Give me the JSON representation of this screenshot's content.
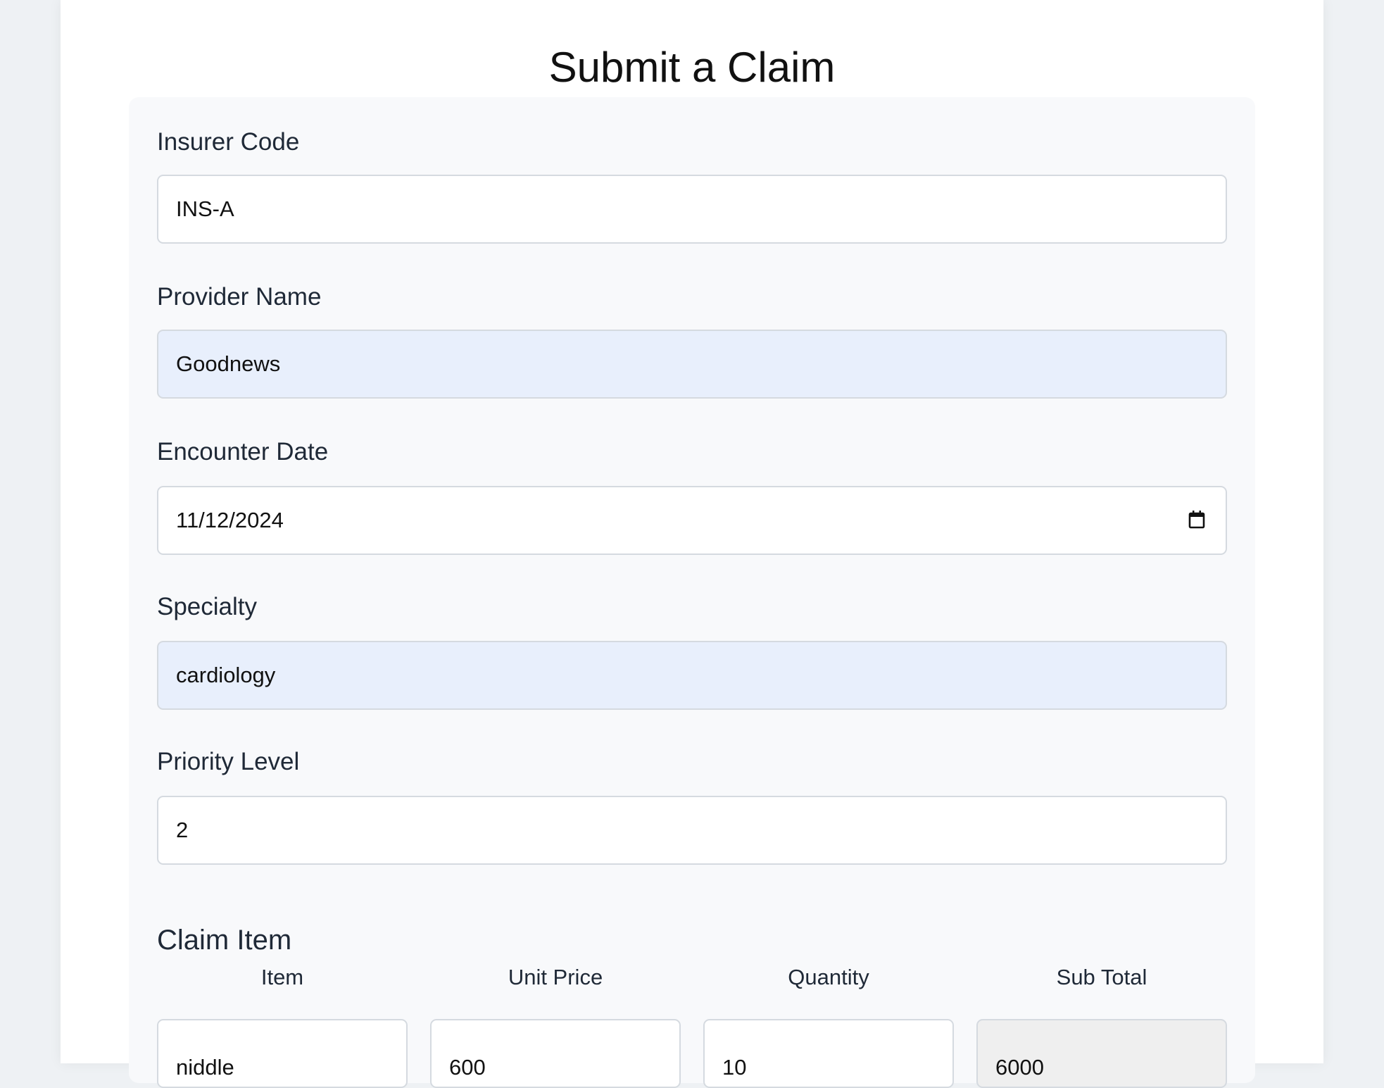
{
  "page": {
    "title": "Submit a Claim"
  },
  "form": {
    "insurer_code": {
      "label": "Insurer Code",
      "value": "INS-A"
    },
    "provider_name": {
      "label": "Provider Name",
      "value": "Goodnews"
    },
    "encounter_date": {
      "label": "Encounter Date",
      "value": "11/12/2024"
    },
    "specialty": {
      "label": "Specialty",
      "value": "cardiology"
    },
    "priority_level": {
      "label": "Priority Level",
      "value": "2"
    }
  },
  "claim_item": {
    "section_title": "Claim Item",
    "headers": {
      "item": "Item",
      "unit_price": "Unit Price",
      "quantity": "Quantity",
      "sub_total": "Sub Total"
    },
    "row": {
      "item": "niddle",
      "unit_price": "600",
      "quantity": "10",
      "sub_total": "6000"
    }
  },
  "icons": {
    "calendar": "calendar-icon"
  },
  "colors": {
    "autofill_background": "#e8effc",
    "readonly_background": "#efefef",
    "card_background": "#f8f9fb"
  }
}
